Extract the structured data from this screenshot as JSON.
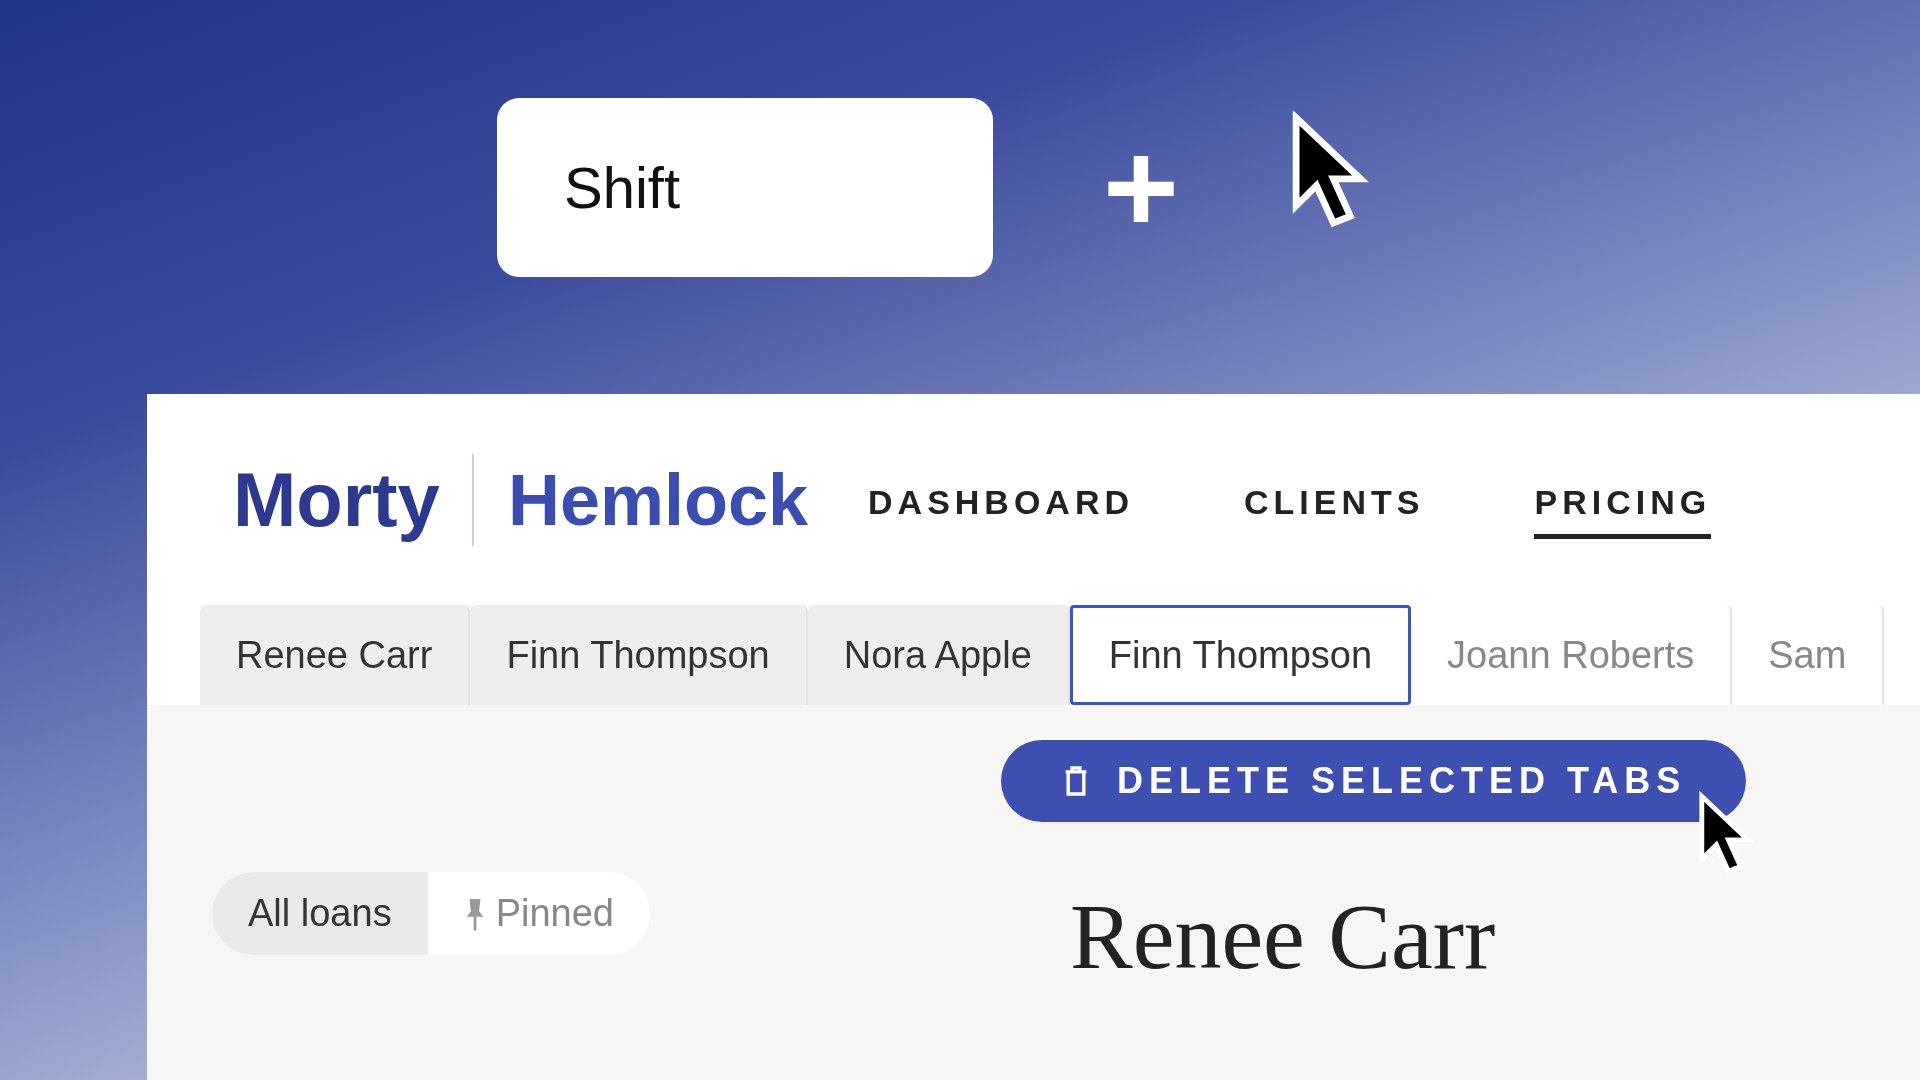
{
  "shortcut": {
    "key": "Shift",
    "plus": "+"
  },
  "brand": {
    "name": "Morty",
    "partner": "Hemlock"
  },
  "nav": [
    {
      "label": "DASHBOARD",
      "selected": false
    },
    {
      "label": "CLIENTS",
      "selected": false
    },
    {
      "label": "PRICING",
      "selected": true
    }
  ],
  "tabs": [
    {
      "label": "Renee Carr",
      "selected": true,
      "focused": false
    },
    {
      "label": "Finn Thompson",
      "selected": true,
      "focused": false
    },
    {
      "label": "Nora Apple",
      "selected": true,
      "focused": false
    },
    {
      "label": "Finn Thompson",
      "selected": false,
      "focused": true
    },
    {
      "label": "Joann Roberts",
      "selected": false,
      "focused": false
    },
    {
      "label": "Sam",
      "selected": false,
      "focused": false
    }
  ],
  "delete_button": {
    "label": "DELETE SELECTED TABS"
  },
  "filter": [
    {
      "label": "All loans",
      "selected": true
    },
    {
      "label": "Pinned",
      "selected": false
    }
  ],
  "heading": "Renee Carr"
}
